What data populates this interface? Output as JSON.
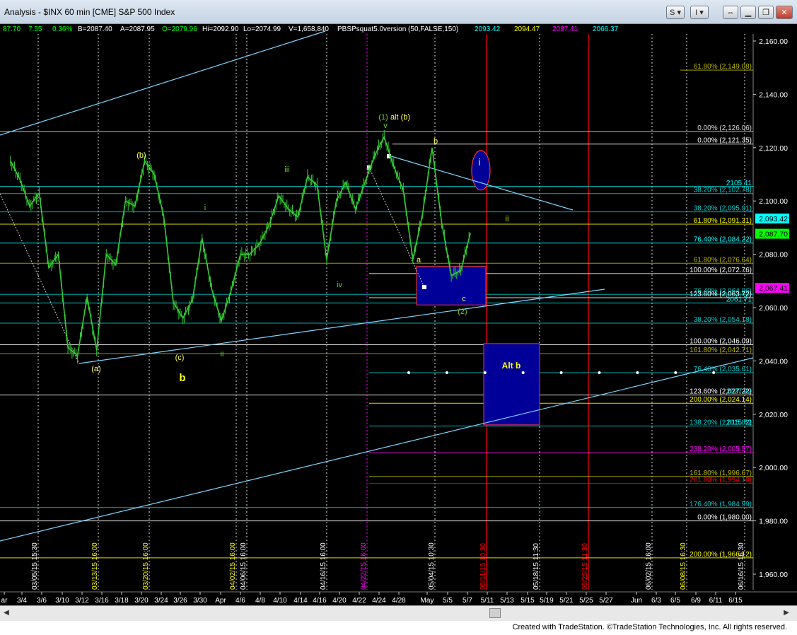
{
  "window": {
    "title": "Analysis - $INX 60 min [CME] S&P 500 Index",
    "btn_s": "S",
    "btn_i": "I",
    "icons": [
      "link-icon",
      "minimize-icon",
      "restore-icon",
      "close-icon"
    ]
  },
  "header_items": [
    {
      "text": "87.70",
      "color": "#00ff00"
    },
    {
      "text": "7.55",
      "color": "#00ff00"
    },
    {
      "text": "0.36%",
      "color": "#00ff00"
    },
    {
      "text": "B=2087.40",
      "color": "#ffffff"
    },
    {
      "text": "A=2087.95",
      "color": "#ffffff"
    },
    {
      "text": "O=2079.96",
      "color": "#00ff00"
    },
    {
      "text": "Hi=2092.90",
      "color": "#ffffff"
    },
    {
      "text": "Lo=2074.99",
      "color": "#ffffff"
    },
    {
      "text": "V=1,658,840",
      "color": "#ffffff"
    },
    {
      "text": "PBSPsquat5.0version (50,FALSE,150)",
      "color": "#ffffff"
    },
    {
      "text": "2093.42",
      "color": "#00ffff"
    },
    {
      "text": "2094.47",
      "color": "#ffff00"
    },
    {
      "text": "2087.41",
      "color": "#ff00ff"
    },
    {
      "text": "2066.37",
      "color": "#00ffff"
    }
  ],
  "footer": "Created with TradeStation. ©TradeStation Technologies, Inc. All rights reserved.",
  "chart_data": {
    "type": "line",
    "title": "$INX 60 min S&P 500 Index",
    "ylim": [
      1952,
      2166
    ],
    "y_ticks": [
      1960,
      1980,
      2000,
      2020,
      2040,
      2060,
      2080,
      2100,
      2120,
      2140,
      2160
    ],
    "y_tick_labels": [
      "1,960.00",
      "1,980.00",
      "2,000.00",
      "2,020.00",
      "2,040.00",
      "2,060.00",
      "2,080.00",
      "2,100.00",
      "2,120.00",
      "2,140.00",
      "2,160.00"
    ],
    "x_tick_labels": [
      "ar",
      "3/4",
      "3/6",
      "3/10",
      "3/12",
      "3/16",
      "3/18",
      "3/20",
      "3/24",
      "3/26",
      "3/30",
      "Apr",
      "4/6",
      "4/8",
      "4/10",
      "4/14",
      "4/16",
      "4/20",
      "4/22",
      "4/24",
      "4/28",
      "May",
      "5/5",
      "5/7",
      "5/11",
      "5/13",
      "5/15",
      "5/19",
      "5/21",
      "5/25",
      "5/27",
      "Jun",
      "6/3",
      "6/5",
      "6/9",
      "6/11",
      "6/15"
    ],
    "price_series": [
      {
        "x": "3/2",
        "y": 2115
      },
      {
        "x": "3/3",
        "y": 2108
      },
      {
        "x": "3/4",
        "y": 2098
      },
      {
        "x": "3/5",
        "y": 2103
      },
      {
        "x": "3/6",
        "y": 2075
      },
      {
        "x": "3/9",
        "y": 2080
      },
      {
        "x": "3/10",
        "y": 2045
      },
      {
        "x": "3/11",
        "y": 2042
      },
      {
        "x": "3/12",
        "y": 2064
      },
      {
        "x": "3/13",
        "y": 2044
      },
      {
        "x": "3/16",
        "y": 2080
      },
      {
        "x": "3/17",
        "y": 2076
      },
      {
        "x": "3/18",
        "y": 2100
      },
      {
        "x": "3/19",
        "y": 2098
      },
      {
        "x": "3/20",
        "y": 2115
      },
      {
        "x": "3/23",
        "y": 2110
      },
      {
        "x": "3/24",
        "y": 2094
      },
      {
        "x": "3/25",
        "y": 2062
      },
      {
        "x": "3/26",
        "y": 2056
      },
      {
        "x": "3/27",
        "y": 2063
      },
      {
        "x": "3/30",
        "y": 2086
      },
      {
        "x": "3/31",
        "y": 2067
      },
      {
        "x": "4/1",
        "y": 2055
      },
      {
        "x": "4/2",
        "y": 2066
      },
      {
        "x": "4/6",
        "y": 2080
      },
      {
        "x": "4/7",
        "y": 2080
      },
      {
        "x": "4/8",
        "y": 2084
      },
      {
        "x": "4/9",
        "y": 2091
      },
      {
        "x": "4/10",
        "y": 2102
      },
      {
        "x": "4/13",
        "y": 2097
      },
      {
        "x": "4/14",
        "y": 2094
      },
      {
        "x": "4/15",
        "y": 2109
      },
      {
        "x": "4/16",
        "y": 2106
      },
      {
        "x": "4/17",
        "y": 2078
      },
      {
        "x": "4/20",
        "y": 2100
      },
      {
        "x": "4/21",
        "y": 2107
      },
      {
        "x": "4/22",
        "y": 2097
      },
      {
        "x": "4/23",
        "y": 2107
      },
      {
        "x": "4/24",
        "y": 2117
      },
      {
        "x": "4/27",
        "y": 2124
      },
      {
        "x": "4/28",
        "y": 2113
      },
      {
        "x": "4/29",
        "y": 2104
      },
      {
        "x": "4/30",
        "y": 2078
      },
      {
        "x": "5/1",
        "y": 2095
      },
      {
        "x": "5/4",
        "y": 2120
      },
      {
        "x": "5/5",
        "y": 2092
      },
      {
        "x": "5/6",
        "y": 2072
      },
      {
        "x": "5/7",
        "y": 2074
      },
      {
        "x": "5/8",
        "y": 2088
      }
    ],
    "horizontal_levels": [
      {
        "label": "61.80% (2,149.08)",
        "value": 2149.08,
        "color": "#b8b800"
      },
      {
        "label": "0.00% (2,126.06)",
        "value": 2126.06,
        "color": "#dddddd"
      },
      {
        "label": "0.00% (2,121.35)",
        "value": 2121.35,
        "color": "#ffffff"
      },
      {
        "label": "2105.41",
        "value": 2105.41,
        "color": "#00ffff"
      },
      {
        "label": "38.20% (2,102.78)",
        "value": 2102.78,
        "color": "#00cccc"
      },
      {
        "label": "38.20% (2,095.91)",
        "value": 2095.91,
        "color": "#00cccc"
      },
      {
        "label": "61.80% (2,091.31)",
        "value": 2091.31,
        "color": "#ffff00"
      },
      {
        "label": "76.40% (2,084.22)",
        "value": 2084.22,
        "color": "#00ffff"
      },
      {
        "label": "61.80% (2,076.64)",
        "value": 2076.64,
        "color": "#b8b800"
      },
      {
        "label": "100.00% (2,072.76)",
        "value": 2072.76,
        "color": "#ffffff"
      },
      {
        "label": "76.40% (2,064.96)",
        "value": 2064.96,
        "color": "#00cccc"
      },
      {
        "label": "123.60% (2,063.72)",
        "value": 2063.72,
        "color": "#ffffff"
      },
      {
        "label": "2061.71",
        "value": 2061.71,
        "color": "#00ffff"
      },
      {
        "label": "38.20% (2,054.18)",
        "value": 2054.18,
        "color": "#00cccc"
      },
      {
        "label": "100.00% (2,046.09)",
        "value": 2046.09,
        "color": "#ffffff"
      },
      {
        "label": "161.80% (2,042.71)",
        "value": 2042.71,
        "color": "#b8b800"
      },
      {
        "label": "76.40% (2,035.61)",
        "value": 2035.61,
        "color": "#00cccc"
      },
      {
        "label": "123.60% (2,027.22)",
        "value": 2027.22,
        "color": "#ffffff"
      },
      {
        "label": "2027.22",
        "value": 2027.22,
        "color": "#00ffff"
      },
      {
        "label": "200.00% (2,024.14)",
        "value": 2024.14,
        "color": "#ffff00"
      },
      {
        "label": "138.20% (2,015.62)",
        "value": 2015.62,
        "color": "#00cccc"
      },
      {
        "label": "2015.62",
        "value": 2015.62,
        "color": "#00ffff"
      },
      {
        "label": "238.20% (2,005.57)",
        "value": 2005.57,
        "color": "#ff00ff"
      },
      {
        "label": "161.80% (1,996.67)",
        "value": 1996.67,
        "color": "#b8b800"
      },
      {
        "label": "261.80% (1,994.10)",
        "value": 1994.1,
        "color": "#ff0000"
      },
      {
        "label": "176.40% (1,984.99)",
        "value": 1984.99,
        "color": "#00cccc"
      },
      {
        "label": "0.00% (1,980.00)",
        "value": 1980.0,
        "color": "#ffffff"
      },
      {
        "label": "200.00% (1,966.12)",
        "value": 1966.12,
        "color": "#ffff00"
      }
    ],
    "price_badges": [
      {
        "text": "2,093.42",
        "value": 2093.42,
        "bg": "#00ffff"
      },
      {
        "text": "2,087.70",
        "value": 2087.7,
        "bg": "#00ff00"
      },
      {
        "text": "2,067.41",
        "value": 2067.41,
        "bg": "#ff00ff"
      }
    ],
    "vertical_labels": [
      {
        "text": "03/05/15 15:30",
        "color": "#ffffff"
      },
      {
        "text": "03/13/15 16:00",
        "color": "#ffff00"
      },
      {
        "text": "03/20/15 16:00",
        "color": "#ffff00"
      },
      {
        "text": "04/02/15 16:00",
        "color": "#ffff00"
      },
      {
        "text": "04/06/15 16:00",
        "color": "#ffffff"
      },
      {
        "text": "04/16/15 16:00",
        "color": "#ffffff"
      },
      {
        "text": "04/22/15 16:00",
        "color": "#ff00ff"
      },
      {
        "text": "05/04/15 10:30",
        "color": "#ffffff"
      },
      {
        "text": "05/11/15 10:30",
        "color": "#ff0000"
      },
      {
        "text": "05/18/15 11:30",
        "color": "#ffffff"
      },
      {
        "text": "05/25/15 11:30",
        "color": "#ff0000"
      },
      {
        "text": "06/02/15 16:00",
        "color": "#ffffff"
      },
      {
        "text": "06/08/15 16:30",
        "color": "#ffff00"
      },
      {
        "text": "06/16/15 16:30",
        "color": "#ffffff"
      }
    ],
    "wave_labels": [
      {
        "text": "(a)",
        "color": "#ffff66"
      },
      {
        "text": "(b)",
        "color": "#ffff66"
      },
      {
        "text": "(c)",
        "color": "#ffff66"
      },
      {
        "text": "b",
        "color": "#ffff00"
      },
      {
        "text": "i",
        "color": "#66cc33"
      },
      {
        "text": "ii",
        "color": "#66cc33"
      },
      {
        "text": "iii",
        "color": "#66cc33"
      },
      {
        "text": "iv",
        "color": "#66cc33"
      },
      {
        "text": "v",
        "color": "#66cc33"
      },
      {
        "text": "(1)",
        "color": "#66cc33"
      },
      {
        "text": "alt (b)",
        "color": "#ffff66"
      },
      {
        "text": "a",
        "color": "#ffff66"
      },
      {
        "text": "b",
        "color": "#ffff66"
      },
      {
        "text": "c",
        "color": "#ffff66"
      },
      {
        "text": "(2)",
        "color": "#66cc33"
      },
      {
        "text": "i",
        "color": "#66cc33"
      },
      {
        "text": "ii",
        "color": "#99cc00"
      },
      {
        "text": "Alt b",
        "color": "#ffff00"
      }
    ],
    "annotations": {
      "target_box_label": "Alt b"
    },
    "colors": {
      "background": "#000000",
      "price": "#33cc33",
      "trendline": "#7fd4ff",
      "box": "#00008b"
    }
  }
}
